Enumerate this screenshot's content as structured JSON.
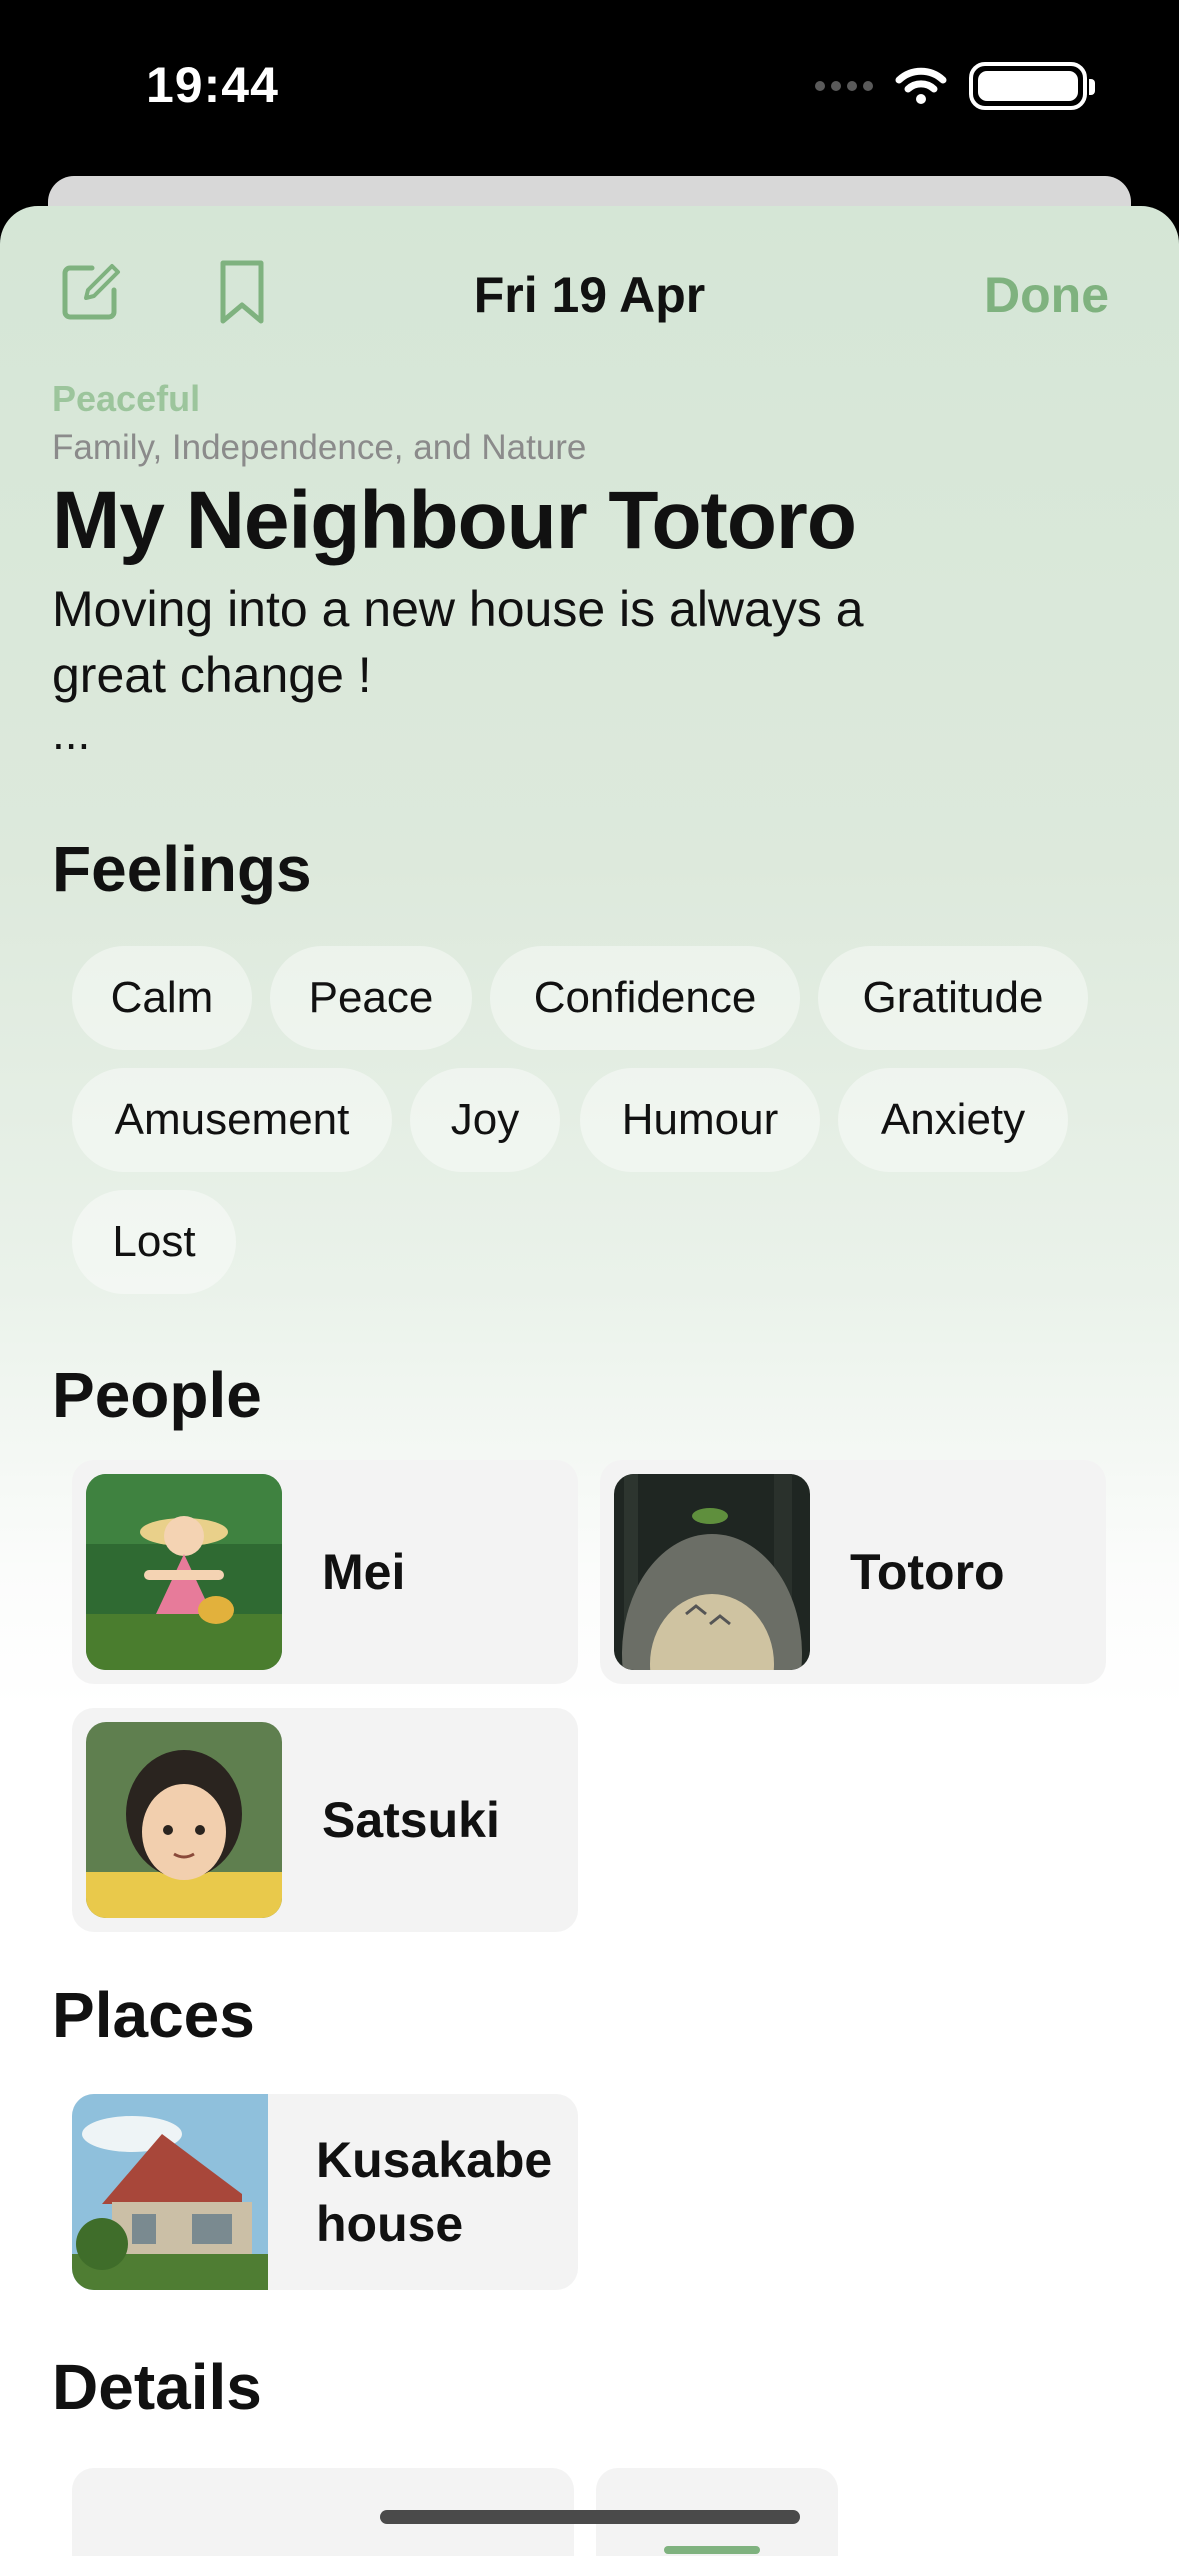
{
  "status_bar": {
    "time": "19:44"
  },
  "toolbar": {
    "date": "Fri 19 Apr",
    "done_label": "Done"
  },
  "entry": {
    "mood": "Peaceful",
    "themes": "Family, Independence, and Nature",
    "title": "My Neighbour Totoro",
    "description": "Moving into a new house is always a great change !",
    "ellipsis": "..."
  },
  "sections": {
    "feelings": "Feelings",
    "people": "People",
    "places": "Places",
    "details": "Details"
  },
  "feelings": [
    "Calm",
    "Peace",
    "Confidence",
    "Gratitude",
    "Amusement",
    "Joy",
    "Humour",
    "Anxiety",
    "Lost"
  ],
  "people": [
    {
      "name": "Mei"
    },
    {
      "name": "Totoro"
    },
    {
      "name": "Satsuki"
    }
  ],
  "places": [
    {
      "name": "Kusakabe house"
    }
  ],
  "colors": {
    "accent": "#7fb27f",
    "mood": "#9cc59c",
    "sheet_top": "#d5e6d6",
    "tile_bg": "#f3f3f3"
  }
}
